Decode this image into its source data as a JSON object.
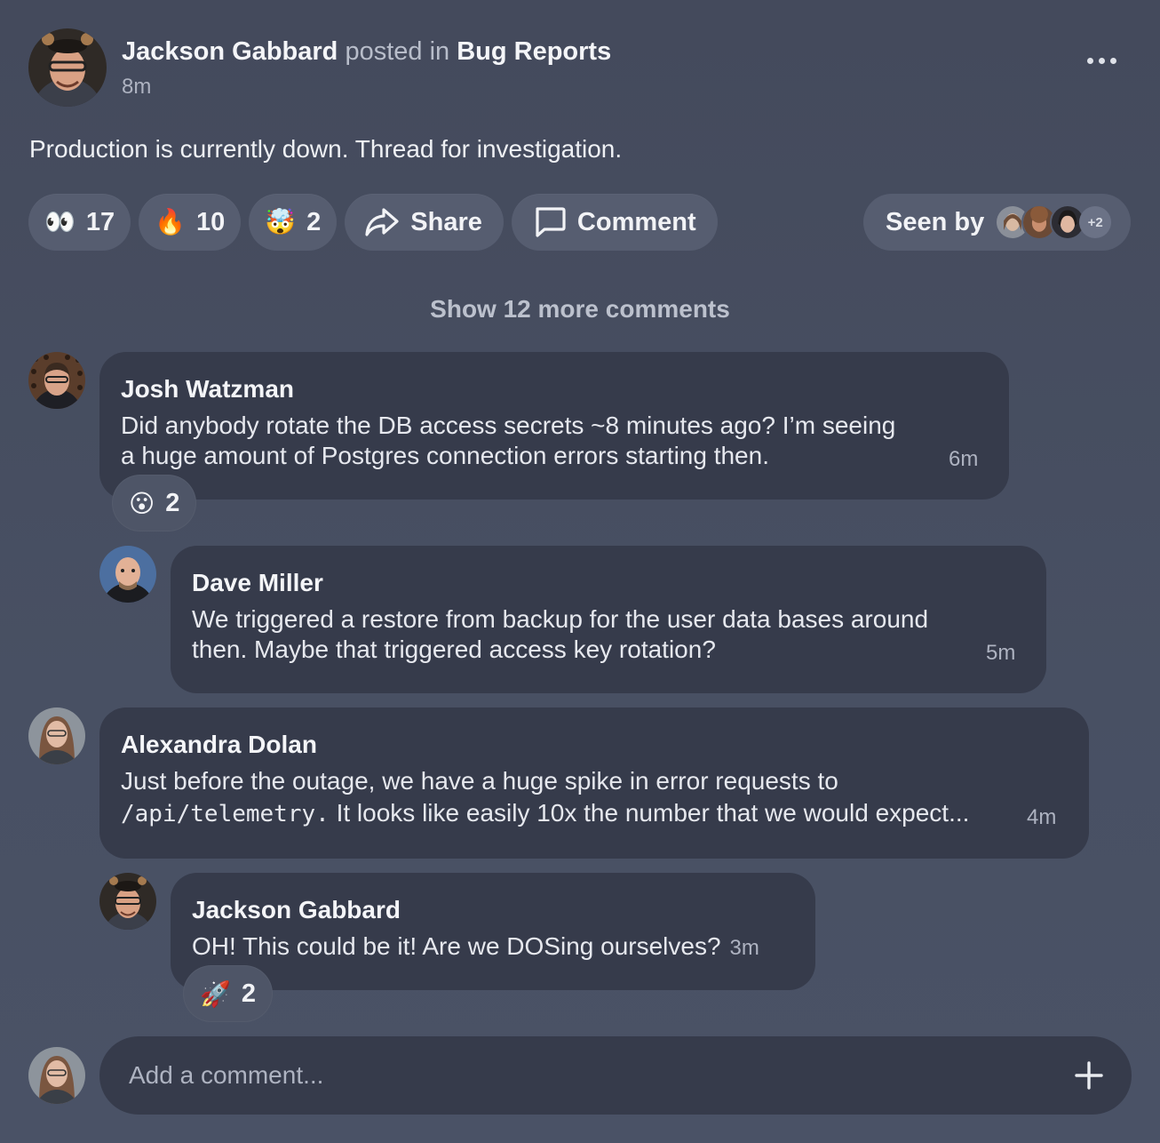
{
  "post": {
    "author": "Jackson Gabbard",
    "posted_in_text": "posted in",
    "channel": "Bug Reports",
    "time": "8m",
    "body": "Production is currently down. Thread for investigation."
  },
  "reactions": [
    {
      "emoji": "👀",
      "icon": "eyes-emoji",
      "count": "17"
    },
    {
      "emoji": "🔥",
      "icon": "fire-emoji",
      "count": "10"
    },
    {
      "emoji": "🤯",
      "icon": "exploding-head-emoji",
      "count": "2"
    }
  ],
  "actions": {
    "share_label": "Share",
    "comment_label": "Comment"
  },
  "seen_by": {
    "label": "Seen by",
    "more": "+2"
  },
  "show_more_label": "Show 12 more comments",
  "comments": [
    {
      "author": "Josh Watzman",
      "lines": [
        "Did anybody rotate the DB access secrets ~8 minutes ago? I’m seeing",
        "a huge amount of Postgres connection errors starting then."
      ],
      "time": "6m",
      "reaction": {
        "emoji": "😮",
        "icon": "surprised-emoji",
        "count": "2"
      }
    },
    {
      "author": "Dave Miller",
      "lines": [
        "We triggered a restore from backup for the user data bases around",
        "then. Maybe that triggered access key rotation?"
      ],
      "time": "5m"
    },
    {
      "author": "Alexandra Dolan",
      "line1": "Just before the outage, we have a huge spike in error requests to",
      "code": "/api/telemetry.",
      "line2_rest": " It looks like easily 10x the number that we would expect...",
      "time": "4m"
    },
    {
      "author": "Jackson Gabbard",
      "text": "OH! This could be it! Are we DOSing ourselves?",
      "time": "3m",
      "reaction": {
        "emoji": "🚀",
        "icon": "rocket-emoji",
        "count": "2"
      }
    }
  ],
  "composer": {
    "placeholder": "Add a comment..."
  },
  "colors": {
    "background": "#474e61",
    "bubble": "#363b4b",
    "pill": "#565d70"
  }
}
